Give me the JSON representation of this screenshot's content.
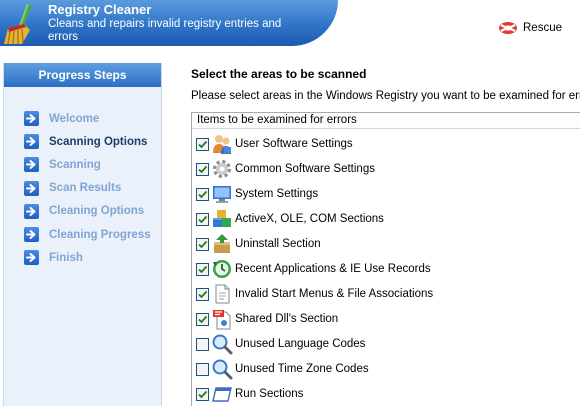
{
  "app": {
    "title": "Registry Cleaner",
    "subtitle": "Cleans and repairs invalid registry entries and errors"
  },
  "toolbar": {
    "rescue_label": "Rescue",
    "rescue_icon": "lifebuoy-icon"
  },
  "sidebar": {
    "title": "Progress Steps",
    "items": [
      {
        "label": "Welcome",
        "state": "pending",
        "icon": "arrow-right-icon"
      },
      {
        "label": "Scanning Options",
        "state": "current",
        "icon": "arrow-right-icon"
      },
      {
        "label": "Scanning",
        "state": "pending",
        "icon": "arrow-right-icon"
      },
      {
        "label": "Scan Results",
        "state": "pending",
        "icon": "arrow-right-icon"
      },
      {
        "label": "Cleaning Options",
        "state": "pending",
        "icon": "arrow-right-icon"
      },
      {
        "label": "Cleaning Progress",
        "state": "pending",
        "icon": "arrow-right-icon"
      },
      {
        "label": "Finish",
        "state": "pending",
        "icon": "arrow-right-icon"
      }
    ]
  },
  "main": {
    "title": "Select the areas to be scanned",
    "description": "Please select areas in the Windows Registry you want to be examined for errors.",
    "list_header": "Items to be examined for errors",
    "items": [
      {
        "label": "User Software Settings",
        "checked": true,
        "icon": "users-icon"
      },
      {
        "label": "Common Software Settings",
        "checked": true,
        "icon": "gear-icon"
      },
      {
        "label": "System Settings",
        "checked": true,
        "icon": "monitor-icon"
      },
      {
        "label": "ActiveX, OLE, COM Sections",
        "checked": true,
        "icon": "blocks-icon"
      },
      {
        "label": "Uninstall Section",
        "checked": true,
        "icon": "uninstall-box-icon"
      },
      {
        "label": "Recent Applications & IE Use Records",
        "checked": true,
        "icon": "history-clock-icon"
      },
      {
        "label": "Invalid Start Menus & File Associations",
        "checked": true,
        "icon": "document-icon"
      },
      {
        "label": "Shared Dll's Section",
        "checked": true,
        "icon": "dll-file-icon"
      },
      {
        "label": "Unused Language Codes",
        "checked": false,
        "icon": "magnifier-icon"
      },
      {
        "label": "Unused Time Zone Codes",
        "checked": false,
        "icon": "magnifier-icon"
      },
      {
        "label": "Run Sections",
        "checked": true,
        "icon": "run-window-icon"
      }
    ]
  }
}
